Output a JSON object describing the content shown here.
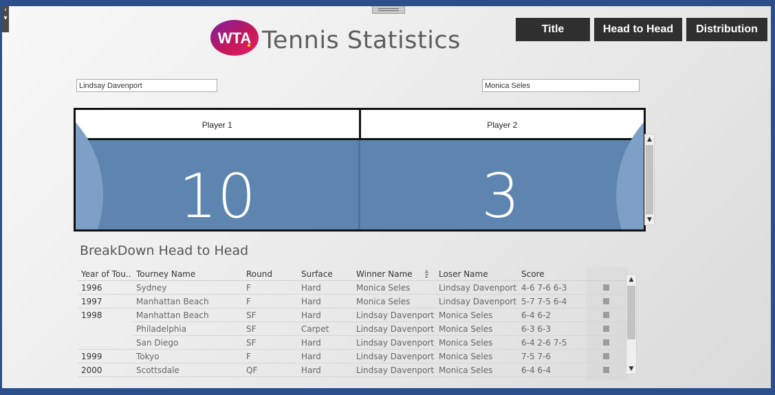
{
  "app": {
    "logo_text": "WTA",
    "title": "Tennis Statistics"
  },
  "nav": [
    {
      "label": "Title"
    },
    {
      "label": "Head to Head"
    },
    {
      "label": "Distribution"
    }
  ],
  "players": {
    "player1_value": "Lindsay Davenport",
    "player2_value": "Monica Seles"
  },
  "head_to_head": {
    "player1_label": "Player 1",
    "player2_label": "Player 2",
    "player1_wins": "10",
    "player2_wins": "3",
    "colors": {
      "panel": "#5d85b0",
      "arc": "#7e9fc6"
    }
  },
  "breakdown": {
    "title": "BreakDown Head to Head",
    "columns": [
      "Year of Tou..",
      "Tourney Name",
      "Round",
      "Surface",
      "Winner Name",
      "Loser Name",
      "Score"
    ],
    "rows": [
      {
        "year": "1996",
        "tourney": "Sydney",
        "round": "F",
        "surface": "Hard",
        "winner": "Monica Seles",
        "loser": "Lindsay Davenport",
        "score": "4-6 7-6 6-3"
      },
      {
        "year": "1997",
        "tourney": "Manhattan Beach",
        "round": "F",
        "surface": "Hard",
        "winner": "Monica Seles",
        "loser": "Lindsay Davenport",
        "score": "5-7 7-5 6-4"
      },
      {
        "year": "1998",
        "tourney": "Manhattan Beach",
        "round": "SF",
        "surface": "Hard",
        "winner": "Lindsay Davenport",
        "loser": "Monica Seles",
        "score": "6-4 6-2"
      },
      {
        "year": "",
        "tourney": "Philadelphia",
        "round": "SF",
        "surface": "Carpet",
        "winner": "Lindsay Davenport",
        "loser": "Monica Seles",
        "score": "6-3 6-3"
      },
      {
        "year": "",
        "tourney": "San Diego",
        "round": "SF",
        "surface": "Hard",
        "winner": "Lindsay Davenport",
        "loser": "Monica Seles",
        "score": "6-4 2-6 7-5"
      },
      {
        "year": "1999",
        "tourney": "Tokyo",
        "round": "F",
        "surface": "Hard",
        "winner": "Lindsay Davenport",
        "loser": "Monica Seles",
        "score": "7-5 7-6"
      },
      {
        "year": "2000",
        "tourney": "Scottsdale",
        "round": "QF",
        "surface": "Hard",
        "winner": "Lindsay Davenport",
        "loser": "Monica Seles",
        "score": "6-4 6-4"
      }
    ]
  }
}
